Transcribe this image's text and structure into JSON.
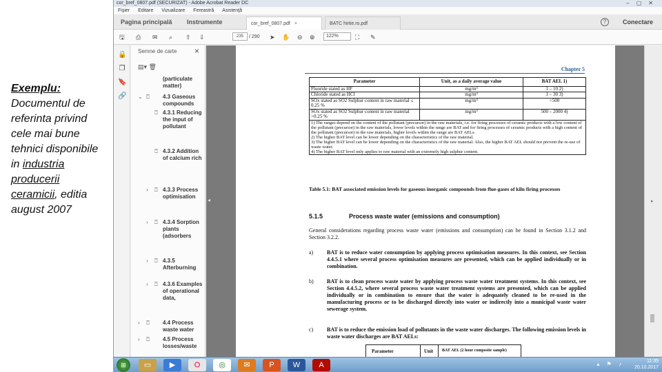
{
  "slide": {
    "heading": "Exemplu:",
    "text_before": "Documentul de referinta privind cele mai bune tehnici disponibile in ",
    "underlined": "industria producerii ceramicii",
    "text_after": ", editia august 2007"
  },
  "window": {
    "title": "cor_bref_0807.pdf (SECURIZAT) - Adobe Acrobat Reader DC",
    "menu": [
      "Fişier",
      "Editare",
      "Vizualizare",
      "Fereastră",
      "Asistenţă"
    ]
  },
  "tabs": {
    "home": "Pagina principală",
    "tools": "Instrumente",
    "doc1": "cor_bref_0807.pdf",
    "doc2": "BATC hirtie.ro.pdf",
    "connect": "Conectare",
    "close_glyph": "×"
  },
  "toolbar": {
    "page_current": "235",
    "page_total": "/ 290",
    "zoom": "122%"
  },
  "bookmarks": {
    "header": "Semne de carte",
    "items": [
      "(particulate matter)",
      "4.3 Gaseous compounds",
      "4.3.1 Reducing the input of pollutant",
      "4.3.2 Addition of calcium rich",
      "4.3.3 Process optimisation",
      "4.3.4 Sorption plants (adsorbers",
      "4.3.5 Afterburning",
      "4.3.6 Examples of operational data,",
      "4.4 Process waste water",
      "4.5 Process losses/waste"
    ]
  },
  "document": {
    "chapter": "Chapter 5",
    "table": {
      "headers": [
        "Parameter",
        "Unit, as a daily average value",
        "BAT AEL 1)"
      ],
      "rows": [
        [
          "Fluoride stated as HF",
          "mg/m³",
          "1 – 10 2)"
        ],
        [
          "Chloride stated as HCl",
          "mg/m³",
          "1 – 30 3)"
        ],
        [
          "SOx stated as SO2 Sulphur content in raw material ≤ 0.25 %",
          "mg/m³",
          "<500"
        ],
        [
          "SOx stated as SO2 Sulphur content in raw material >0.25 %",
          "mg/m³",
          "500 – 2000 4)"
        ]
      ],
      "notes": [
        "1) The ranges depend on the content of the pollutant (precursor) in the raw materials, i.e. for firing processes of ceramic products with a low content of the pollutant (precursor) in the raw materials, lower levels within the range are BAT and for firing processes of ceramic products with a high content of the pollutant (precursor) in the raw materials, higher levels within the range are BAT AELs.",
        "2) The higher BAT level can be lower depending on the characteristics of the raw material.",
        "3) The higher BAT level can be lower depending on the characteristics of the raw material. Also, the higher BAT AEL should not prevent the re-use of waste water.",
        "4) The higher BAT level only applies to raw material with an extremely high sulphur content."
      ]
    },
    "caption": "Table 5.1: BAT associated emission levels for gaseous inorganic compounds from flue-gases of kiln firing processes",
    "section_number": "5.1.5",
    "section_title": "Process waste water (emissions and consumption)",
    "intro": "General considerations regarding process waste water (emissions and consumption) can be found in Section 3.1.2 and Section 3.2.2.",
    "items": [
      {
        "label": "a)",
        "text": "BAT is to reduce water consumption by applying process optimisation measures. In this context, see Section 4.4.5.1 where several process optimisation measures are presented, which can be applied individually or in combination."
      },
      {
        "label": "b)",
        "text": "BAT is to clean process waste water by applying process waste water treatment systems. In this context, see Section 4.4.5.2, where several process waste water treatment systems are presented, which can be applied individually or in combination to ensure that the water is adequately cleaned to be re-used in the manufacturing process or to be discharged directly into water or indirectly into a municipal waste water sewerage system."
      },
      {
        "label": "c)",
        "text": "BAT is to reduce the emission load of pollutants in the waste water discharges. The following emission levels in waste water discharges are BAT AELs:"
      }
    ],
    "bottom_table": [
      "Parameter",
      "Unit",
      "BAT AEL (2 hour composite sample)"
    ]
  },
  "taskbar": {
    "start": "⊞",
    "time": "11:35",
    "date": "20.10.2017"
  }
}
